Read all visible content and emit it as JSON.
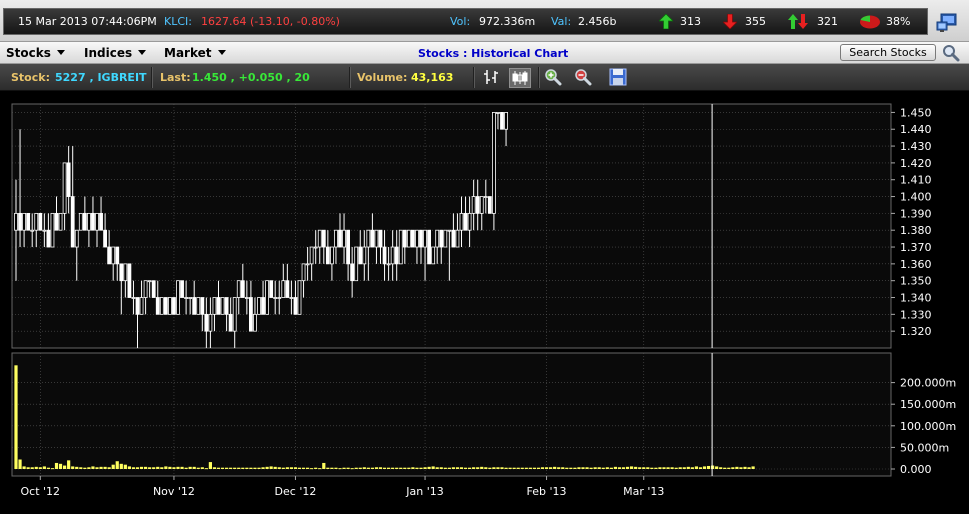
{
  "ticker": {
    "datetime": "15 Mar 2013 07:44:06PM",
    "klci_label": "KLCI:",
    "klci_value": "1627.64 (-13.10, -0.80%)",
    "vol_label": "Vol:",
    "vol_value": "972.336m",
    "val_label": "Val:",
    "val_value": "2.456b",
    "up_count": "313",
    "down_count": "355",
    "unchanged_count": "321",
    "pct": "38%"
  },
  "menu": {
    "stocks": "Stocks",
    "indices": "Indices",
    "market": "Market",
    "title": "Stocks : Historical Chart",
    "search": "Search Stocks"
  },
  "info": {
    "stock_label": "Stock:",
    "stock_value": "5227 , IGBREIT",
    "last_label": "Last:",
    "last_value": "1.450 , +0.050 , 20",
    "volume_label": "Volume:",
    "volume_value": "43,163"
  },
  "chart_data": {
    "type": "candlestick",
    "price_axis": [
      "1.450",
      "1.440",
      "1.430",
      "1.420",
      "1.410",
      "1.400",
      "1.390",
      "1.380",
      "1.370",
      "1.360",
      "1.350",
      "1.340",
      "1.330",
      "1.320"
    ],
    "price_range": [
      1.31,
      1.455
    ],
    "volume_axis": [
      "200.000m",
      "150.000m",
      "100.000m",
      "50.000m",
      "0.000"
    ],
    "volume_range": [
      0,
      250
    ],
    "x_labels": [
      "Oct '12",
      "Nov '12",
      "Dec '12",
      "Jan '13",
      "Feb '13",
      "Mar '13"
    ],
    "x_label_bar_index": [
      6,
      39,
      69,
      101,
      131,
      155
    ],
    "cursor_bar_index": 172,
    "bars": [
      [
        1.38,
        1.41,
        1.35,
        1.39
      ],
      [
        1.39,
        1.44,
        1.37,
        1.38
      ],
      [
        1.38,
        1.39,
        1.37,
        1.39
      ],
      [
        1.39,
        1.39,
        1.38,
        1.38
      ],
      [
        1.38,
        1.39,
        1.37,
        1.38
      ],
      [
        1.38,
        1.39,
        1.37,
        1.39
      ],
      [
        1.39,
        1.39,
        1.38,
        1.38
      ],
      [
        1.38,
        1.39,
        1.37,
        1.38
      ],
      [
        1.38,
        1.39,
        1.37,
        1.37
      ],
      [
        1.37,
        1.39,
        1.37,
        1.39
      ],
      [
        1.39,
        1.4,
        1.38,
        1.38
      ],
      [
        1.38,
        1.39,
        1.38,
        1.39
      ],
      [
        1.39,
        1.4,
        1.38,
        1.42
      ],
      [
        1.42,
        1.43,
        1.39,
        1.4
      ],
      [
        1.4,
        1.43,
        1.38,
        1.37
      ],
      [
        1.37,
        1.38,
        1.35,
        1.38
      ],
      [
        1.38,
        1.39,
        1.38,
        1.39
      ],
      [
        1.39,
        1.4,
        1.38,
        1.38
      ],
      [
        1.38,
        1.39,
        1.37,
        1.39
      ],
      [
        1.39,
        1.4,
        1.38,
        1.38
      ],
      [
        1.38,
        1.39,
        1.37,
        1.39
      ],
      [
        1.39,
        1.4,
        1.38,
        1.38
      ],
      [
        1.38,
        1.39,
        1.37,
        1.37
      ],
      [
        1.37,
        1.38,
        1.36,
        1.36
      ],
      [
        1.36,
        1.37,
        1.35,
        1.37
      ],
      [
        1.37,
        1.37,
        1.35,
        1.36
      ],
      [
        1.36,
        1.36,
        1.33,
        1.35
      ],
      [
        1.35,
        1.36,
        1.34,
        1.36
      ],
      [
        1.36,
        1.36,
        1.34,
        1.34
      ],
      [
        1.34,
        1.35,
        1.33,
        1.34
      ],
      [
        1.34,
        1.34,
        1.31,
        1.33
      ],
      [
        1.33,
        1.35,
        1.33,
        1.34
      ],
      [
        1.34,
        1.35,
        1.33,
        1.35
      ],
      [
        1.35,
        1.35,
        1.34,
        1.35
      ],
      [
        1.35,
        1.35,
        1.34,
        1.34
      ],
      [
        1.34,
        1.35,
        1.33,
        1.33
      ],
      [
        1.33,
        1.34,
        1.33,
        1.34
      ],
      [
        1.34,
        1.34,
        1.33,
        1.33
      ],
      [
        1.33,
        1.34,
        1.33,
        1.34
      ],
      [
        1.34,
        1.34,
        1.33,
        1.33
      ],
      [
        1.33,
        1.35,
        1.33,
        1.35
      ],
      [
        1.35,
        1.35,
        1.34,
        1.34
      ],
      [
        1.34,
        1.35,
        1.33,
        1.34
      ],
      [
        1.34,
        1.34,
        1.33,
        1.34
      ],
      [
        1.34,
        1.35,
        1.33,
        1.33
      ],
      [
        1.33,
        1.34,
        1.33,
        1.34
      ],
      [
        1.34,
        1.34,
        1.32,
        1.33
      ],
      [
        1.33,
        1.34,
        1.31,
        1.32
      ],
      [
        1.32,
        1.34,
        1.31,
        1.33
      ],
      [
        1.33,
        1.34,
        1.32,
        1.34
      ],
      [
        1.34,
        1.35,
        1.33,
        1.33
      ],
      [
        1.33,
        1.34,
        1.33,
        1.34
      ],
      [
        1.34,
        1.34,
        1.32,
        1.33
      ],
      [
        1.33,
        1.34,
        1.32,
        1.32
      ],
      [
        1.32,
        1.34,
        1.31,
        1.34
      ],
      [
        1.34,
        1.35,
        1.33,
        1.35
      ],
      [
        1.35,
        1.36,
        1.34,
        1.34
      ],
      [
        1.34,
        1.35,
        1.33,
        1.34
      ],
      [
        1.34,
        1.35,
        1.32,
        1.32
      ],
      [
        1.32,
        1.34,
        1.32,
        1.33
      ],
      [
        1.33,
        1.34,
        1.33,
        1.34
      ],
      [
        1.34,
        1.35,
        1.33,
        1.33
      ],
      [
        1.33,
        1.35,
        1.33,
        1.35
      ],
      [
        1.35,
        1.35,
        1.34,
        1.34
      ],
      [
        1.34,
        1.35,
        1.33,
        1.34
      ],
      [
        1.34,
        1.35,
        1.33,
        1.34
      ],
      [
        1.34,
        1.36,
        1.34,
        1.35
      ],
      [
        1.35,
        1.36,
        1.34,
        1.34
      ],
      [
        1.34,
        1.35,
        1.33,
        1.34
      ],
      [
        1.34,
        1.35,
        1.33,
        1.33
      ],
      [
        1.33,
        1.35,
        1.33,
        1.35
      ],
      [
        1.35,
        1.36,
        1.34,
        1.36
      ],
      [
        1.36,
        1.37,
        1.35,
        1.36
      ],
      [
        1.36,
        1.37,
        1.35,
        1.37
      ],
      [
        1.37,
        1.38,
        1.36,
        1.37
      ],
      [
        1.37,
        1.38,
        1.36,
        1.38
      ],
      [
        1.38,
        1.38,
        1.36,
        1.37
      ],
      [
        1.37,
        1.38,
        1.36,
        1.36
      ],
      [
        1.36,
        1.37,
        1.35,
        1.37
      ],
      [
        1.37,
        1.38,
        1.36,
        1.38
      ],
      [
        1.38,
        1.39,
        1.37,
        1.37
      ],
      [
        1.37,
        1.39,
        1.36,
        1.38
      ],
      [
        1.38,
        1.38,
        1.35,
        1.36
      ],
      [
        1.36,
        1.37,
        1.34,
        1.35
      ],
      [
        1.35,
        1.37,
        1.35,
        1.37
      ],
      [
        1.37,
        1.38,
        1.36,
        1.36
      ],
      [
        1.36,
        1.38,
        1.35,
        1.37
      ],
      [
        1.37,
        1.38,
        1.35,
        1.38
      ],
      [
        1.38,
        1.39,
        1.37,
        1.37
      ],
      [
        1.37,
        1.38,
        1.36,
        1.38
      ],
      [
        1.38,
        1.38,
        1.36,
        1.37
      ],
      [
        1.37,
        1.38,
        1.35,
        1.36
      ],
      [
        1.36,
        1.37,
        1.35,
        1.36
      ],
      [
        1.36,
        1.38,
        1.35,
        1.37
      ],
      [
        1.37,
        1.38,
        1.35,
        1.36
      ],
      [
        1.36,
        1.38,
        1.36,
        1.38
      ],
      [
        1.38,
        1.38,
        1.36,
        1.37
      ],
      [
        1.37,
        1.38,
        1.37,
        1.38
      ],
      [
        1.38,
        1.38,
        1.37,
        1.37
      ],
      [
        1.37,
        1.38,
        1.36,
        1.38
      ],
      [
        1.38,
        1.38,
        1.36,
        1.37
      ],
      [
        1.37,
        1.38,
        1.35,
        1.38
      ],
      [
        1.38,
        1.38,
        1.36,
        1.36
      ],
      [
        1.36,
        1.37,
        1.36,
        1.37
      ],
      [
        1.37,
        1.38,
        1.36,
        1.38
      ],
      [
        1.38,
        1.38,
        1.36,
        1.37
      ],
      [
        1.37,
        1.38,
        1.37,
        1.38
      ],
      [
        1.38,
        1.38,
        1.35,
        1.38
      ],
      [
        1.38,
        1.39,
        1.37,
        1.37
      ],
      [
        1.37,
        1.39,
        1.37,
        1.38
      ],
      [
        1.38,
        1.4,
        1.37,
        1.39
      ],
      [
        1.39,
        1.4,
        1.38,
        1.38
      ],
      [
        1.38,
        1.4,
        1.37,
        1.39
      ],
      [
        1.39,
        1.41,
        1.38,
        1.4
      ],
      [
        1.4,
        1.41,
        1.38,
        1.39
      ],
      [
        1.39,
        1.4,
        1.38,
        1.4
      ],
      [
        1.4,
        1.41,
        1.39,
        1.4
      ],
      [
        1.4,
        1.4,
        1.39,
        1.39
      ],
      [
        1.39,
        1.45,
        1.38,
        1.45
      ],
      [
        1.45,
        1.45,
        1.44,
        1.45
      ],
      [
        1.45,
        1.45,
        1.44,
        1.44
      ],
      [
        1.44,
        1.45,
        1.43,
        1.45
      ]
    ],
    "volumes": [
      240,
      22,
      6,
      4,
      4,
      5,
      4,
      6,
      3,
      2,
      14,
      12,
      8,
      20,
      6,
      5,
      4,
      3,
      4,
      6,
      4,
      5,
      5,
      4,
      10,
      18,
      12,
      10,
      6,
      4,
      4,
      5,
      5,
      4,
      4,
      5,
      4,
      6,
      5,
      4,
      5,
      5,
      3,
      5,
      5,
      3,
      4,
      2,
      16,
      4,
      3,
      3,
      3,
      3,
      3,
      3,
      3,
      3,
      3,
      3,
      3,
      4,
      5,
      6,
      5,
      4,
      3,
      4,
      4,
      4,
      3,
      3,
      3,
      2,
      3,
      2,
      14,
      3,
      3,
      3,
      2,
      3,
      3,
      2,
      3,
      3,
      4,
      3,
      3,
      4,
      4,
      3,
      3,
      3,
      3,
      3,
      3,
      3,
      4,
      3,
      3,
      4,
      5,
      6,
      4,
      4,
      3,
      3,
      4,
      4,
      4,
      3,
      3,
      4,
      4,
      5,
      4,
      3,
      4,
      4,
      4,
      3,
      3,
      3,
      3,
      3,
      3,
      3,
      3,
      3,
      4,
      4,
      4,
      5,
      4,
      4,
      3,
      3,
      3,
      4,
      4,
      4,
      3,
      4,
      4,
      3,
      4,
      3,
      5,
      4,
      4,
      5,
      6,
      5,
      4,
      4,
      4,
      3,
      3,
      4,
      4,
      4,
      4,
      3,
      4,
      4,
      5,
      4,
      6,
      4,
      6,
      7,
      8,
      6,
      4,
      3,
      3,
      4,
      5,
      4,
      5,
      4,
      6
    ],
    "colors": {
      "up": "#ffffff",
      "down": "#ffffff",
      "volume": "#ffff60",
      "grid": "#555555"
    }
  }
}
